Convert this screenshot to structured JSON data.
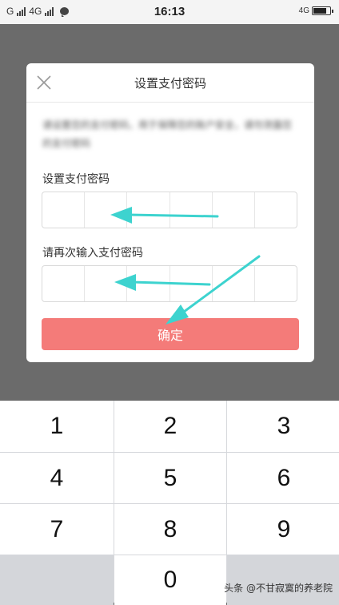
{
  "status_bar": {
    "carrier1": "G",
    "carrier2": "4G",
    "time": "16:13",
    "network": "4G"
  },
  "dialog": {
    "title": "设置支付密码",
    "description": "请设置您的支付密码，用于保障您的账户安全，请勿泄露您的支付密码",
    "field1_label": "设置支付密码",
    "field2_label": "请再次输入支付密码",
    "confirm_label": "确定"
  },
  "keypad": {
    "keys": [
      "1",
      "2",
      "3",
      "4",
      "5",
      "6",
      "7",
      "8",
      "9",
      "",
      "0",
      ""
    ]
  },
  "annotation": {
    "arrow_color": "#3dd3cf"
  },
  "watermark": "头条 @不甘寂寞的养老院"
}
